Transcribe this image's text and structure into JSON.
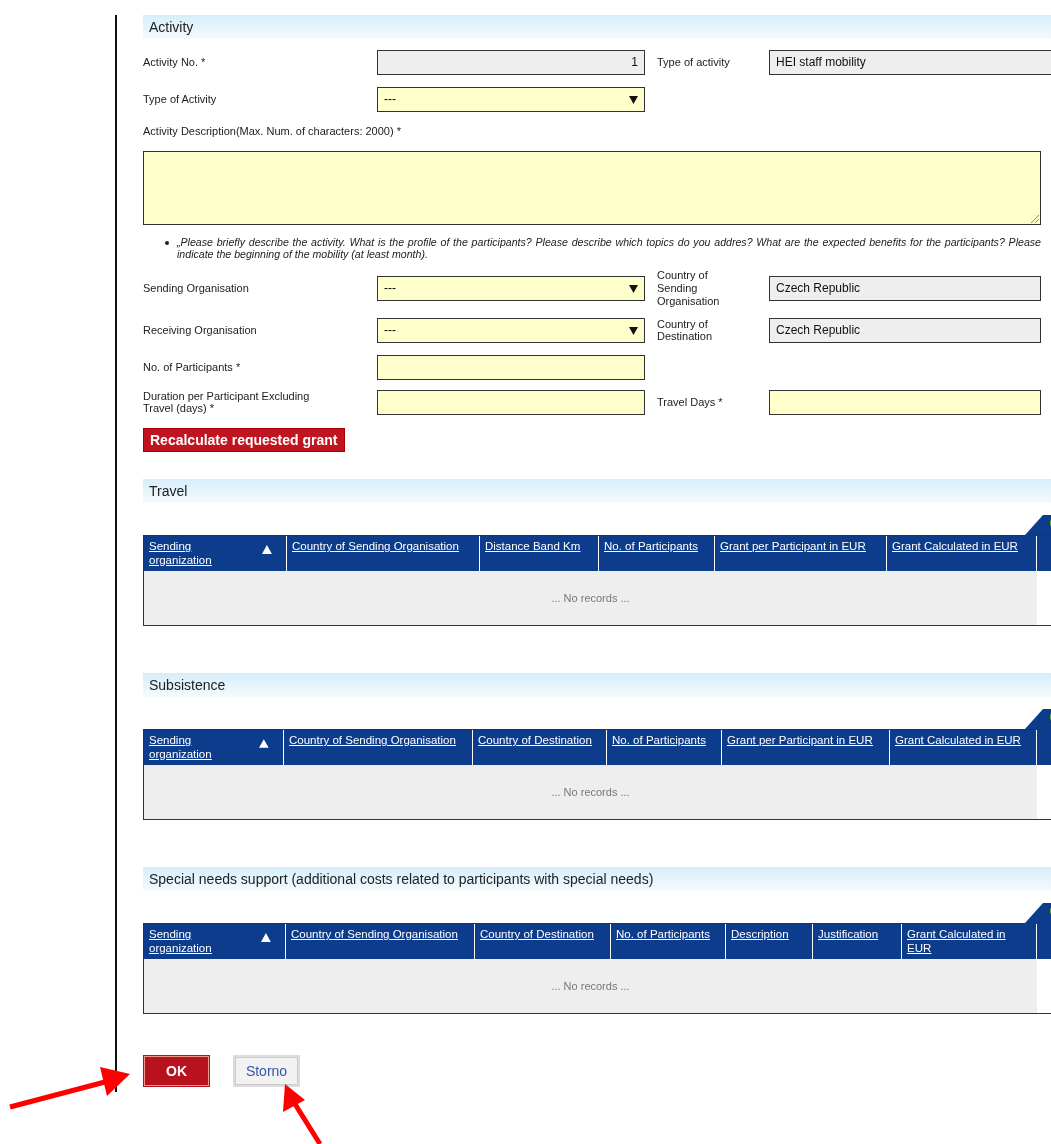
{
  "activity": {
    "title": "Activity",
    "activity_no": {
      "label": "Activity No. *",
      "value": "1"
    },
    "type_fixed": {
      "label": "Type of activity",
      "value": "HEI staff mobility"
    },
    "type_select": {
      "label": "Type of Activity",
      "value": "---"
    },
    "description": {
      "label": "Activity Description(Max. Num. of characters: 2000) *"
    },
    "hint": "„Please briefly describe the activity. What is the profile of the participants? Please describe which topics do you addres? What are the expected benefits for the participants? Please indicate the beginning of the mobility (at least month).",
    "sending": {
      "label": "Sending Organisation",
      "value": "---",
      "country_label": "Country of Sending Organisation",
      "country_value": "Czech Republic"
    },
    "receiving": {
      "label": "Receiving Organisation",
      "value": "---",
      "country_label": "Country of Destination",
      "country_value": "Czech Republic"
    },
    "participants": {
      "label": "No. of Participants *"
    },
    "duration": {
      "label": "Duration per Participant Excluding Travel (days) *",
      "travel_label": "Travel Days *"
    },
    "recalculate_button": "Recalculate requested grant"
  },
  "tables": [
    {
      "title": "Travel",
      "columns": [
        "Sending organization",
        "Country of Sending Organisation",
        "Distance Band Km",
        "No. of Participants",
        "Grant per Participant in EUR",
        "Grant Calculated in EUR"
      ],
      "empty_text": "... No records ..."
    },
    {
      "title": "Subsistence",
      "columns": [
        "Sending organization",
        "Country of Sending Organisation",
        "Country of Destination",
        "No. of Participants",
        "Grant per Participant in EUR",
        "Grant Calculated in EUR"
      ],
      "empty_text": "... No records ..."
    },
    {
      "title": "Special needs support (additional costs related to participants with special needs)",
      "columns": [
        "Sending organization",
        "Country of Sending Organisation",
        "Country of Destination",
        "No. of Participants",
        "Description",
        "Justification",
        "Grant Calculated in EUR"
      ],
      "empty_text": "... No records ..."
    }
  ],
  "buttons": [
    {
      "label": "OK",
      "kind": "primary"
    },
    {
      "label": "Storno",
      "kind": "secondary"
    }
  ]
}
